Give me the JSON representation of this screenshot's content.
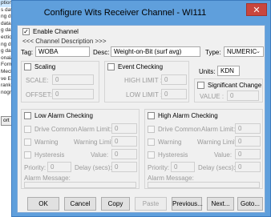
{
  "background": {
    "list_items": [
      "ption",
      "s data ga",
      "ng data g",
      "data ga",
      "g data g",
      "ectics dat",
      "ng data g",
      "g data ga",
      "onal/Surf",
      "Formatio",
      "Mechan",
      "ve Evalu",
      "rank (Pi",
      "nographi"
    ],
    "button_label": "ort"
  },
  "dialog": {
    "title": "Configure Wits Receiver Channel - WI111",
    "close_glyph": "✕"
  },
  "enable": {
    "label": "Enable Channel",
    "checked": true
  },
  "channel_desc_link": "<<< Channel Description >>>",
  "tag": {
    "label": "Tag:",
    "value": "WOBA"
  },
  "desc": {
    "label": "Desc:",
    "value": "Weight-on-Bit (surf avg)"
  },
  "type": {
    "label": "Type:",
    "value": "NUMERIC",
    "arrow": "⌄"
  },
  "scaling": {
    "label": "Scaling",
    "checked": false,
    "scale_label": "SCALE:",
    "scale_value": "0",
    "offset_label": "OFFSET:",
    "offset_value": "0"
  },
  "event_checking": {
    "label": "Event Checking",
    "checked": false,
    "high_label": "HIGH LIMIT :",
    "high_value": "0",
    "low_label": "LOW LIMIT :",
    "low_value": "0"
  },
  "units": {
    "label": "Units:",
    "value": "KDN"
  },
  "significant_change": {
    "label": "Significant Change",
    "checked": false,
    "value_label": "VALUE :",
    "value": "0"
  },
  "low_alarm": {
    "label": "Low Alarm Checking",
    "checked": false,
    "drive_common": "Drive Common",
    "alarm_limit_label": "Alarm Limit:",
    "alarm_limit": "0",
    "warning": "Warning",
    "warning_limit_label": "Warning Limit:",
    "warning_limit": "0",
    "hysteresis": "Hysteresis",
    "value_label": "Value:",
    "value": "0",
    "priority_label": "Priority:",
    "priority": "0",
    "delay_label": "Delay (secs):",
    "delay": "0",
    "message_label": "Alarm Message:"
  },
  "high_alarm": {
    "label": "High Alarm Checking",
    "checked": false,
    "drive_common": "Drive Common",
    "alarm_limit_label": "Alarm Limit:",
    "alarm_limit": "0",
    "warning": "Warning",
    "warning_limit_label": "Warning Limit:",
    "warning_limit": "0",
    "hysteresis": "Hysteresis",
    "value_label": "Value:",
    "value": "0",
    "priority_label": "Priority:",
    "priority": "0",
    "delay_label": "Delay (secs):",
    "delay": "0",
    "message_label": "Alarm Message:"
  },
  "buttons": {
    "ok": "OK",
    "cancel": "Cancel",
    "copy": "Copy",
    "paste": "Paste",
    "previous": "Previous...",
    "next": "Next...",
    "goto": "Goto..."
  }
}
